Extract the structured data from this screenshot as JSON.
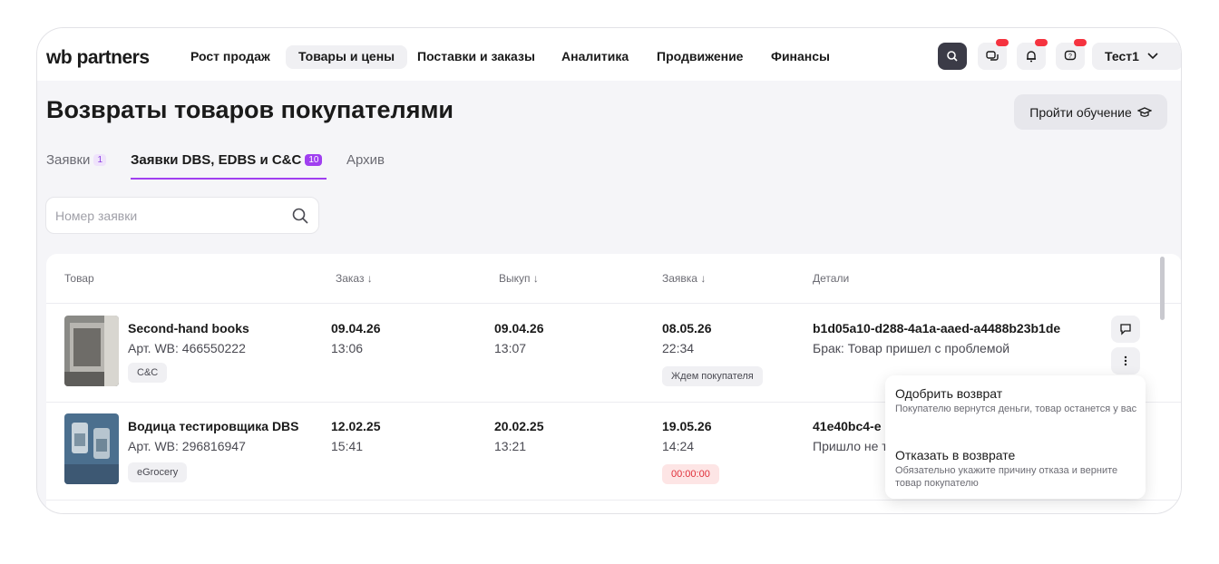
{
  "nav": {
    "logo": "wb partners",
    "items": [
      {
        "label": "Рост продаж",
        "active": false
      },
      {
        "label": "Товары и цены",
        "active": true
      },
      {
        "label": "Поставки и заказы",
        "active": false
      },
      {
        "label": "Аналитика",
        "active": false
      },
      {
        "label": "Продвижение",
        "active": false
      },
      {
        "label": "Финансы",
        "active": false
      }
    ],
    "user": "Тест1"
  },
  "page": {
    "title": "Возвраты товаров покупателями",
    "learn_button": "Пройти обучение"
  },
  "tabs": [
    {
      "label": "Заявки",
      "count": "1",
      "active": false
    },
    {
      "label": "Заявки DBS, EDBS и C&C",
      "count": "10",
      "active": true
    },
    {
      "label": "Архив",
      "count": "",
      "active": false
    }
  ],
  "search": {
    "placeholder": "Номер заявки",
    "value": ""
  },
  "table": {
    "headers": {
      "product": "Товар",
      "order": "Заказ ↓",
      "buyout": "Выкуп ↓",
      "request": "Заявка ↓",
      "details": "Детали"
    },
    "rows": [
      {
        "name": "Second-hand books",
        "article": "Арт. WB: 466550222",
        "chip": "C&C",
        "order_date": "09.04.26",
        "order_time": "13:06",
        "buyout_date": "09.04.26",
        "buyout_time": "13:07",
        "request_date": "08.05.26",
        "request_time": "22:34",
        "status": "Ждем покупателя",
        "details_id": "b1d05a10-d288-4a1a-aaed-a4488b23b1de",
        "details_reason": "Брак: Товар пришел с проблемой"
      },
      {
        "name": "Водица тестировщика DBS",
        "article": "Арт. WB: 296816947",
        "chip": "eGrocery",
        "order_date": "12.02.25",
        "order_time": "15:41",
        "buyout_date": "20.02.25",
        "buyout_time": "13:21",
        "request_date": "19.05.26",
        "request_time": "14:24",
        "status": "00:00:00",
        "details_id": "41e40bc4-e",
        "details_reason": "Пришло не т"
      }
    ]
  },
  "menu": {
    "approve_title": "Одобрить возврат",
    "approve_desc": "Покупателю вернутся деньги, товар останется у вас",
    "reject_title": "Отказать в возврате",
    "reject_desc": "Обязательно укажите причину отказа и верните товар покупателю"
  },
  "colors": {
    "accent": "#a03ff0",
    "alert": "#e0303a",
    "notify": "#f5333f"
  }
}
